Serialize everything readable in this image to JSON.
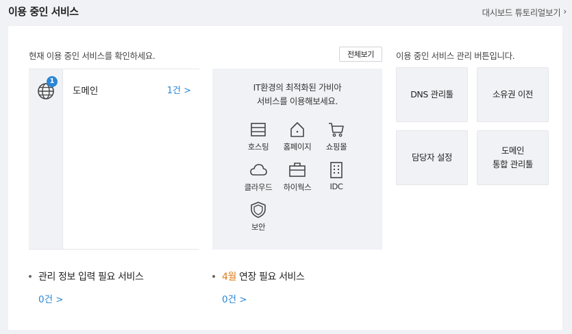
{
  "header": {
    "title": "이용 중인 서비스",
    "tutorial_link": "대시보드 튜토리얼보기",
    "tutorial_chevron": "›"
  },
  "left_panel": {
    "caption": "현재 이용 중인 서비스를 확인하세요.",
    "view_all_label": "전체보기",
    "service": {
      "icon": "globe-icon",
      "badge": "1",
      "name": "도메인",
      "count": "1건 >"
    }
  },
  "promo": {
    "line1": "IT환경의 최적화된 가비아",
    "line2": "서비스를 이용해보세요.",
    "items": [
      {
        "icon": "server-icon",
        "label": "호스팅"
      },
      {
        "icon": "home-icon",
        "label": "홈페이지"
      },
      {
        "icon": "cart-icon",
        "label": "쇼핑몰"
      },
      {
        "icon": "cloud-icon",
        "label": "클라우드"
      },
      {
        "icon": "briefcase-icon",
        "label": "하이웍스"
      },
      {
        "icon": "building-icon",
        "label": "IDC"
      },
      {
        "icon": "shield-icon",
        "label": "보안"
      }
    ]
  },
  "management": {
    "caption": "이용 중인 서비스 관리 버튼입니다.",
    "buttons": [
      {
        "line1": "DNS 관리툴",
        "line2": ""
      },
      {
        "line1": "소유권 이전",
        "line2": ""
      },
      {
        "line1": "담당자 설정",
        "line2": ""
      },
      {
        "line1": "도메인",
        "line2": "통합 관리툴"
      }
    ]
  },
  "alerts": {
    "info_required": {
      "title": "관리 정보 입력 필요 서비스",
      "count": "0건 >"
    },
    "renewal": {
      "month": "4월",
      "title_suffix": " 연장 필요 서비스",
      "count": "0건 >"
    }
  },
  "colors": {
    "accent_blue": "#2a86d6",
    "month_orange": "#e07b17",
    "panel_gray": "#f1f2f6"
  }
}
